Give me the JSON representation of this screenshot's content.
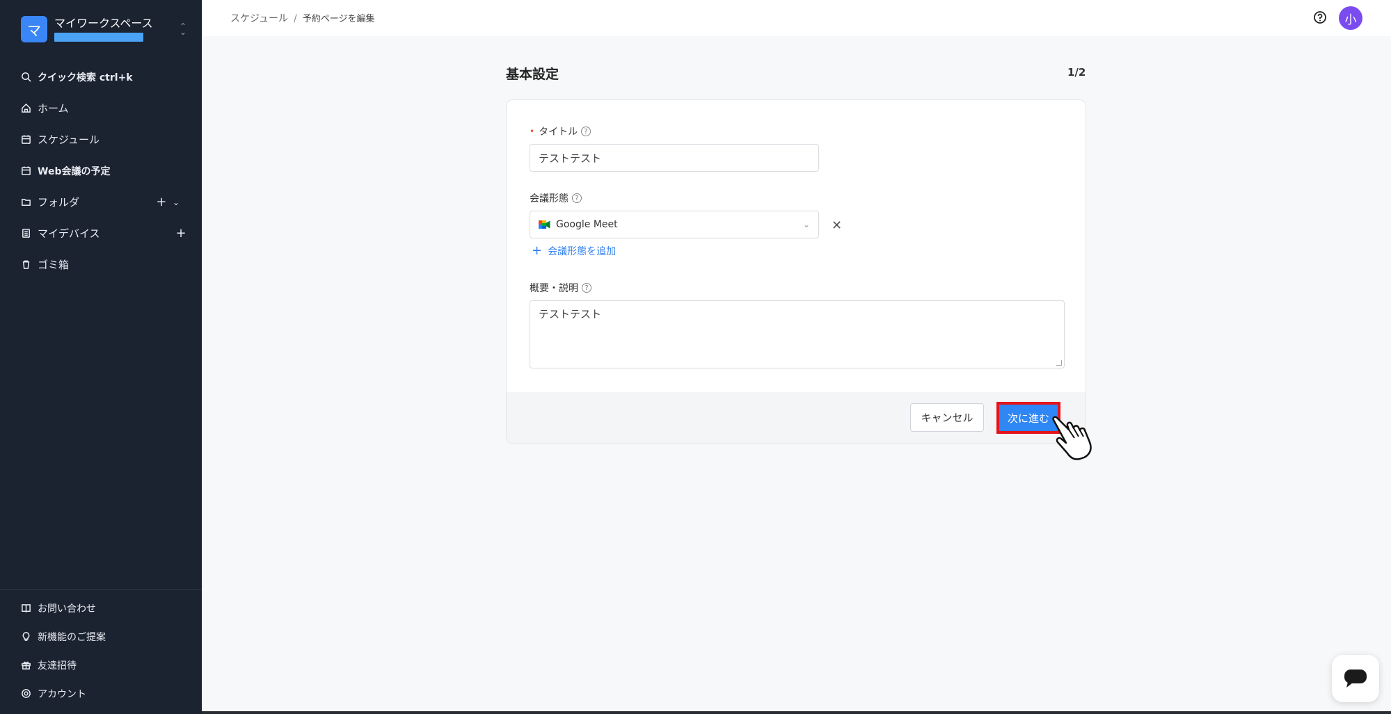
{
  "workspace": {
    "avatar": "マ",
    "name": "マイワークスペース",
    "switch_icon": "chevron-updown-icon"
  },
  "sidebar": {
    "items": [
      {
        "label": "クイック検索 ctrl+k",
        "icon": "search-icon"
      },
      {
        "label": "ホーム",
        "icon": "home-icon"
      },
      {
        "label": "スケジュール",
        "icon": "calendar-icon"
      },
      {
        "label": "Web会議の予定",
        "icon": "calendar-video-icon"
      },
      {
        "label": "フォルダ",
        "icon": "folder-icon",
        "add": "+",
        "expand": "⌄"
      },
      {
        "label": "マイデバイス",
        "icon": "device-icon",
        "add": "+"
      },
      {
        "label": "ゴミ箱",
        "icon": "trash-icon"
      }
    ],
    "bottom_items": [
      {
        "label": "お問い合わせ",
        "icon": "book-icon"
      },
      {
        "label": "新機能のご提案",
        "icon": "lightbulb-icon"
      },
      {
        "label": "友達招待",
        "icon": "gift-icon"
      },
      {
        "label": "アカウント",
        "icon": "account-icon"
      }
    ]
  },
  "breadcrumb": {
    "parent": "スケジュール",
    "separator": "/",
    "current": "予約ページを編集"
  },
  "header": {
    "user_avatar": "小"
  },
  "form": {
    "section_title": "基本設定",
    "step": "1/2",
    "title_label": "タイトル",
    "required_mark": "•",
    "title_value": "テストテスト",
    "meeting_label": "会議形態",
    "meeting_value": "Google Meet",
    "remove": "✕",
    "add_meeting": "会議形態を追加",
    "add_plus": "+",
    "desc_label": "概要・説明",
    "desc_value": "テストテスト",
    "help_mark": "?",
    "cancel": "キャンセル",
    "next": "次に進む"
  },
  "colors": {
    "sidebar_bg": "#1b2230",
    "accent": "#2f86f5",
    "highlight": "#e3141a",
    "avatar": "#7a4cf0"
  }
}
